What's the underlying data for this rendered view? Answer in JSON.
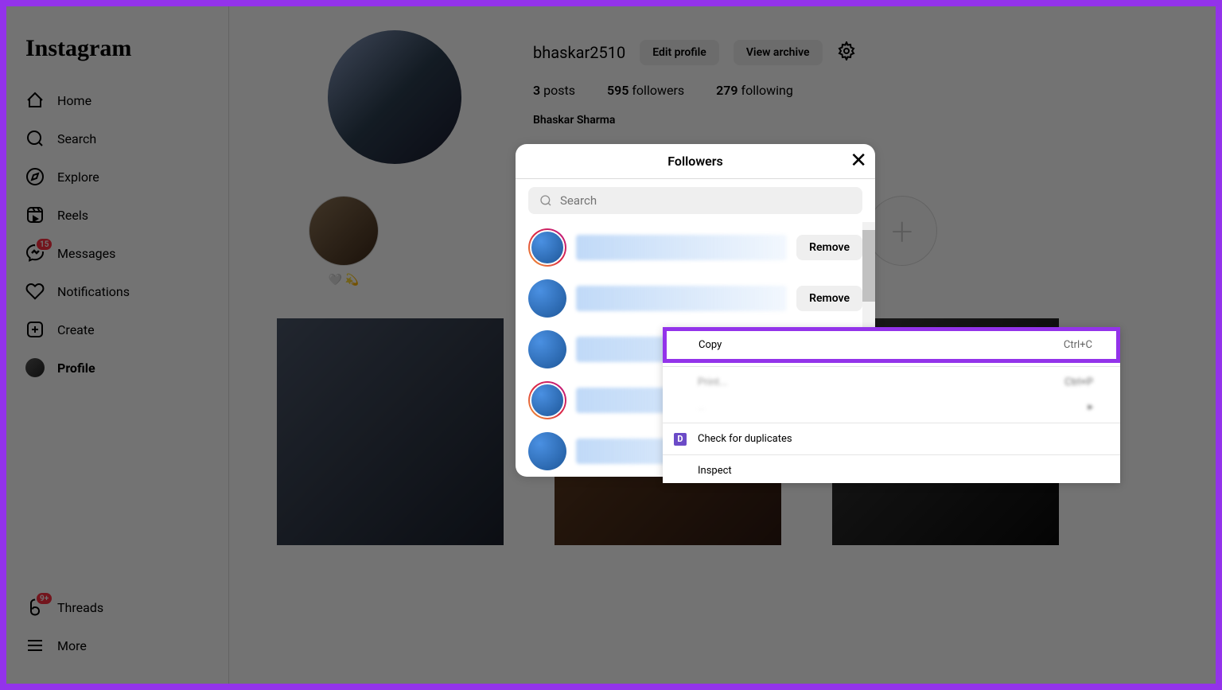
{
  "logo": "Instagram",
  "sidebar": {
    "items": [
      {
        "label": "Home",
        "icon": "home"
      },
      {
        "label": "Search",
        "icon": "search"
      },
      {
        "label": "Explore",
        "icon": "compass"
      },
      {
        "label": "Reels",
        "icon": "reels"
      },
      {
        "label": "Messages",
        "icon": "messenger",
        "badge": "15"
      },
      {
        "label": "Notifications",
        "icon": "heart"
      },
      {
        "label": "Create",
        "icon": "plus-square"
      },
      {
        "label": "Profile",
        "icon": "avatar",
        "active": true
      }
    ],
    "bottom": [
      {
        "label": "Threads",
        "icon": "threads",
        "badge": "9+"
      },
      {
        "label": "More",
        "icon": "menu"
      }
    ]
  },
  "profile": {
    "username": "bhaskar2510",
    "edit_btn": "Edit profile",
    "archive_btn": "View archive",
    "stats": {
      "posts_count": "3",
      "posts_label": "posts",
      "followers_count": "595",
      "followers_label": "followers",
      "following_count": "279",
      "following_label": "following"
    },
    "display_name": "Bhaskar Sharma"
  },
  "modal": {
    "title": "Followers",
    "search_placeholder": "Search",
    "remove_label": "Remove"
  },
  "context_menu": {
    "copy_label": "Copy",
    "copy_shortcut": "Ctrl+C",
    "print_label": "Print...",
    "print_shortcut": "Ctrl+P",
    "dup_label": "Check for duplicates",
    "dup_icon": "D",
    "inspect_label": "Inspect"
  }
}
